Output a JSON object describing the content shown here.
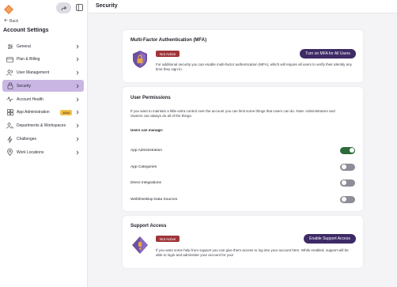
{
  "colors": {
    "accent": "#3d2a66",
    "active_nav": "#c9b6e3",
    "danger": "#a0363a",
    "toggle_on": "#2e6b3a",
    "toggle_off": "#8e8e98",
    "badge": "#f2c14e"
  },
  "sidebar": {
    "back_label": "Back",
    "title": "Account Settings",
    "items": [
      {
        "label": "General",
        "icon": "sliders-icon"
      },
      {
        "label": "Plan & Billing",
        "icon": "credit-card-icon"
      },
      {
        "label": "User Management",
        "icon": "users-icon"
      },
      {
        "label": "Security",
        "icon": "lock-icon",
        "active": true
      },
      {
        "label": "Account Health",
        "icon": "pulse-icon"
      },
      {
        "label": "App Administration",
        "icon": "grid-icon",
        "badge": "1024"
      },
      {
        "label": "Departments & Workspaces",
        "icon": "people-group-icon"
      },
      {
        "label": "Challenges",
        "icon": "lightning-icon"
      },
      {
        "label": "Work Locations",
        "icon": "location-pin-icon"
      }
    ]
  },
  "header": {
    "title": "Security"
  },
  "mfa": {
    "title": "Multi-Factor Authentication (MFA)",
    "status": "Not Active",
    "description": "For additional security you can enable multi-factor authentication (MFA), which will require all users to verify their identity any time they sign-in.",
    "button_label": "Turn on MFA for All Users"
  },
  "permissions": {
    "title": "User Permissions",
    "description": "If you want to maintain a little extra control over the account you can limit some things that Users can do. Note: Administrators and Owners can always do all of the things.",
    "subheading": "Users can manage:",
    "rows": [
      {
        "label": "App Administration",
        "enabled": true
      },
      {
        "label": "App Categories",
        "enabled": false
      },
      {
        "label": "Direct Integrations",
        "enabled": false
      },
      {
        "label": "Web/Desktop Data Sources",
        "enabled": false
      }
    ]
  },
  "support": {
    "title": "Support Access",
    "status": "Not Active",
    "description": "If you want some help from support you can give them access to log into your account here. While enabled, support will be able to login and administer your account for you!",
    "button_label": "Enable Support Access"
  }
}
